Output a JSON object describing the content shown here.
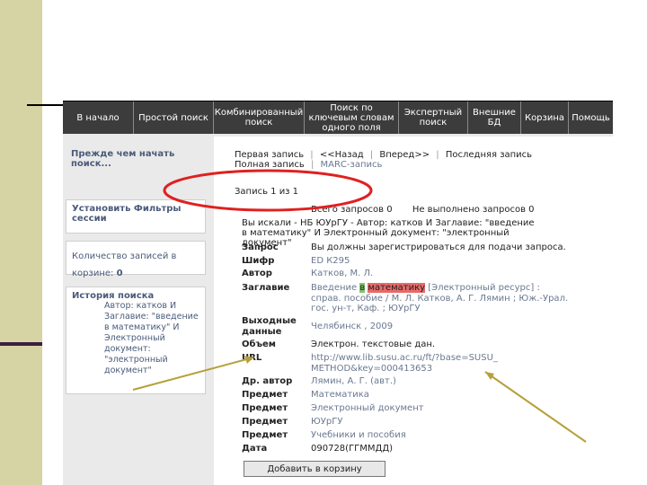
{
  "nav": [
    {
      "label": "В начало"
    },
    {
      "label": "Простой поиск"
    },
    {
      "label": "Комбинированный поиск"
    },
    {
      "label": "Поиск по ключевым словам одного поля"
    },
    {
      "label": "Экспертный поиск"
    },
    {
      "label": "Внешние БД"
    },
    {
      "label": "Корзина"
    },
    {
      "label": "Помощь"
    }
  ],
  "sidebar": {
    "intro": "Прежде чем начать поиск...",
    "filters": "Установить Фильтры сессии",
    "cart_count_label": "Количество записей в корзине: ",
    "cart_count": "0",
    "history_title": "История поиска",
    "history_item": "Автор: катков И Заглавие: \"введение в математику\" И Электронный документ: \"электронный документ\""
  },
  "pager": {
    "first": "Первая запись",
    "sep": "|",
    "back": "<<Назад",
    "forward": "Вперед>>",
    "last": "Последняя запись",
    "full": "Полная запись",
    "marc": "МАRС-запись"
  },
  "record_num": "Запись 1 из 1",
  "stats": {
    "total": "Всего запросов  0",
    "unfinished": "Не выполнено запросов  0"
  },
  "search_query": "Вы искали - НБ ЮУрГУ - Автор: катков И Заглавие: \"введение в математику\" И Электронный документ: \"электронный документ\"",
  "fields": {
    "zapros": {
      "label": "Запрос",
      "value": "Вы должны зарегистрироваться для подачи запроса."
    },
    "shifr": {
      "label": "Шифр",
      "value": "ЕD К295"
    },
    "author": {
      "label": "Автор",
      "value": "Катков, М. Л."
    },
    "title": {
      "label": "Заглавие",
      "pre": "Введение ",
      "hl_green": "в",
      "hl_red": "математику",
      "post": " [Электронный ресурс] : справ. пособие / М. Л. Катков, А. Г. Лямин ; Юж.-Урал. гос. ун-т, Каф. ; ЮУрГУ"
    },
    "imprint": {
      "label": "Выходные данные",
      "value": "Челябинск , 2009"
    },
    "volume": {
      "label": "Объем",
      "value": "Электрон. текстовые дан."
    },
    "url": {
      "label": "URL",
      "value": "http://www.lib.susu.ac.ru/ft/?base=SUSU_METHOD&key=000413653"
    },
    "other_author": {
      "label": "Др. автор",
      "value": "Лямин, А. Г. (авт.)"
    },
    "subject1": {
      "label": "Предмет",
      "value": "Математика"
    },
    "subject2": {
      "label": "Предмет",
      "value": "Электронный документ"
    },
    "subject3": {
      "label": "Предмет",
      "value": "ЮУрГУ"
    },
    "subject4": {
      "label": "Предмет",
      "value": "Учебники и пособия"
    },
    "date": {
      "label": "Дата",
      "value": "090728(ГГММДД)"
    }
  },
  "add_to_cart": "Добавить в корзину",
  "colors": {
    "annotation_red": "#e02020",
    "arrow_olive": "#b5a03a",
    "nav_bg": "#3c3c3c"
  }
}
